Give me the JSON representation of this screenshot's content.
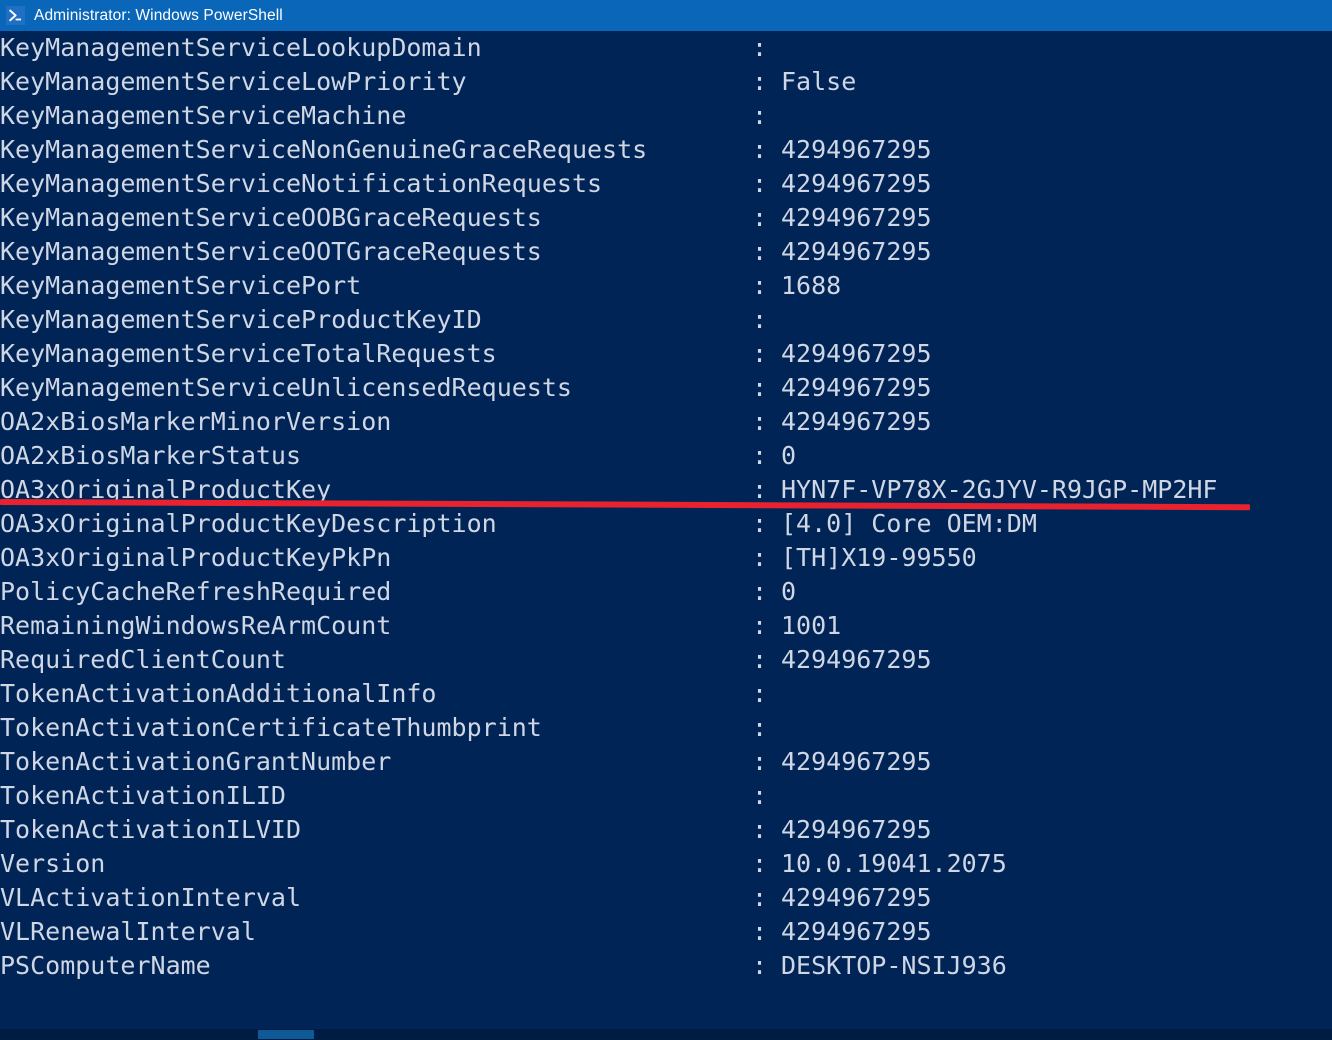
{
  "window": {
    "title": "Administrator: Windows PowerShell",
    "icon": "powershell-prompt-icon",
    "titlebar_color": "#0a66b8",
    "console_background": "#012456",
    "console_foreground": "#cfd6e4"
  },
  "annotation": {
    "underline_color": "#e8222e",
    "underlines_row_index": 17,
    "underlines_property": "OA3xOriginalProductKey"
  },
  "scrollbar": {
    "orientation": "horizontal",
    "track_color": "#011c42",
    "thumb_color": "#0d5a96"
  },
  "console": {
    "separator": ":",
    "rows": [
      {
        "property": "KeyManagementServiceLookupDomain",
        "value": ""
      },
      {
        "property": "KeyManagementServiceLowPriority",
        "value": "False"
      },
      {
        "property": "KeyManagementServiceMachine",
        "value": ""
      },
      {
        "property": "KeyManagementServiceNonGenuineGraceRequests",
        "value": "4294967295"
      },
      {
        "property": "KeyManagementServiceNotificationRequests",
        "value": "4294967295"
      },
      {
        "property": "KeyManagementServiceOOBGraceRequests",
        "value": "4294967295"
      },
      {
        "property": "KeyManagementServiceOOTGraceRequests",
        "value": "4294967295"
      },
      {
        "property": "KeyManagementServicePort",
        "value": "1688"
      },
      {
        "property": "KeyManagementServiceProductKeyID",
        "value": ""
      },
      {
        "property": "KeyManagementServiceTotalRequests",
        "value": "4294967295"
      },
      {
        "property": "KeyManagementServiceUnlicensedRequests",
        "value": "4294967295"
      },
      {
        "property": "OA2xBiosMarkerMinorVersion",
        "value": "4294967295"
      },
      {
        "property": "OA2xBiosMarkerStatus",
        "value": "0"
      },
      {
        "property": "OA3xOriginalProductKey",
        "value": "HYN7F-VP78X-2GJYV-R9JGP-MP2HF"
      },
      {
        "property": "OA3xOriginalProductKeyDescription",
        "value": "[4.0] Core OEM:DM"
      },
      {
        "property": "OA3xOriginalProductKeyPkPn",
        "value": "[TH]X19-99550"
      },
      {
        "property": "PolicyCacheRefreshRequired",
        "value": "0"
      },
      {
        "property": "RemainingWindowsReArmCount",
        "value": "1001"
      },
      {
        "property": "RequiredClientCount",
        "value": "4294967295"
      },
      {
        "property": "TokenActivationAdditionalInfo",
        "value": ""
      },
      {
        "property": "TokenActivationCertificateThumbprint",
        "value": ""
      },
      {
        "property": "TokenActivationGrantNumber",
        "value": "4294967295"
      },
      {
        "property": "TokenActivationILID",
        "value": ""
      },
      {
        "property": "TokenActivationILVID",
        "value": "4294967295"
      },
      {
        "property": "Version",
        "value": "10.0.19041.2075"
      },
      {
        "property": "VLActivationInterval",
        "value": "4294967295"
      },
      {
        "property": "VLRenewalInterval",
        "value": "4294967295"
      },
      {
        "property": "PSComputerName",
        "value": "DESKTOP-NSIJ936"
      }
    ]
  }
}
